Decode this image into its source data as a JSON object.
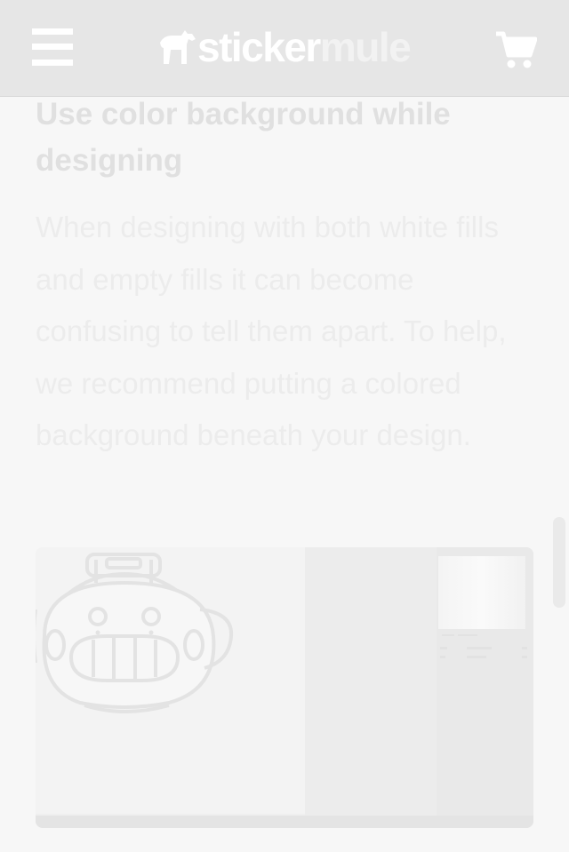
{
  "header": {
    "menu_icon": "hamburger-menu-icon",
    "logo_part1": "sticker",
    "logo_part2": "mule",
    "cart_icon": "shopping-cart-icon"
  },
  "article": {
    "heading": "Use color background while designing",
    "body": "When designing with both white fills and empty fills it can become confusing to tell them apart. To help, we recommend putting a colored background beneath your design."
  },
  "figure": {
    "icon": "robot-mascot-illustration"
  }
}
